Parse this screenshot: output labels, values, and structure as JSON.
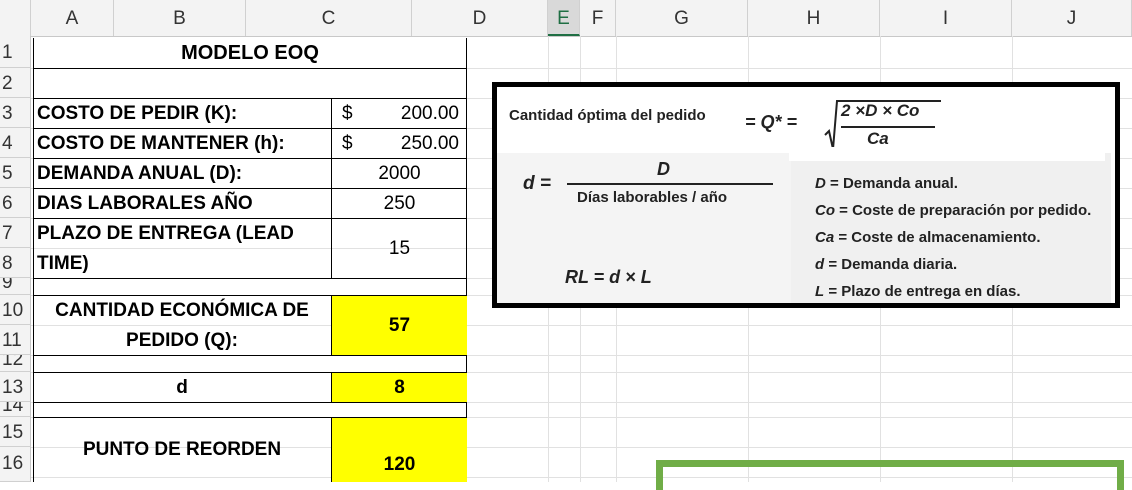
{
  "columns": [
    "A",
    "B",
    "C",
    "D",
    "E",
    "F",
    "G",
    "H",
    "I",
    "J"
  ],
  "selected_column": "E",
  "rows": [
    "1",
    "2",
    "3",
    "4",
    "5",
    "6",
    "7",
    "8",
    "9",
    "10",
    "11",
    "12",
    "13",
    "14",
    "15",
    "16"
  ],
  "sheet": {
    "title": "MODELO EOQ",
    "k_label": "COSTO DE PEDIR (K):",
    "k_currency": "$",
    "k_value": "200.00",
    "h_label": "COSTO DE MANTENER (h):",
    "h_currency": "$",
    "h_value": "250.00",
    "d_label": "DEMANDA ANUAL (D):",
    "d_value": "2000",
    "days_label": "DIAS LABORALES AÑO",
    "days_value": "250",
    "lead_label_1": "PLAZO DE ENTREGA (LEAD",
    "lead_label_2": "TIME)",
    "lead_value": "15",
    "q_label_1": "CANTIDAD ECONÓMICA DE",
    "q_label_2": "PEDIDO (Q):",
    "q_value": "57",
    "dd_label": "d",
    "dd_value": "8",
    "rop_label": "PUNTO DE REORDEN",
    "rop_value": "120"
  },
  "formulas": {
    "q_text": "Cantidad óptima del pedido",
    "q_eq": "= Q* =",
    "q_num": "2 ×D × Co",
    "q_den": "Ca",
    "d_lhs": "d =",
    "d_num": "D",
    "d_den": "Días laborables / año",
    "rl": "RL = d × L",
    "legend": [
      {
        "sym": "D",
        "text": " = Demanda anual."
      },
      {
        "sym": "Co",
        "text": " = Coste de preparación por pedido."
      },
      {
        "sym": "Ca",
        "text": " = Coste de almacenamiento."
      },
      {
        "sym": "d",
        "text": " = Demanda diaria."
      },
      {
        "sym": "L",
        "text": " = Plazo de entrega en días."
      }
    ]
  },
  "colors": {
    "highlight": "#ffff00",
    "selected": "#1f6e43",
    "green_shape": "#70ad47"
  }
}
